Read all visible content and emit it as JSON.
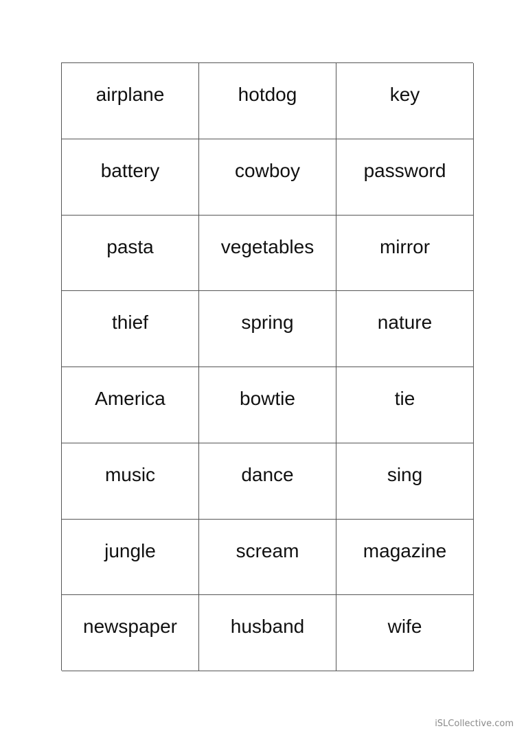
{
  "cards": [
    "airplane",
    "hotdog",
    "key",
    "battery",
    "cowboy",
    "password",
    "pasta",
    "vegetables",
    "mirror",
    "thief",
    "spring",
    "nature",
    "America",
    "bowtie",
    "tie",
    "music",
    "dance",
    "sing",
    "jungle",
    "scream",
    "magazine",
    "newspaper",
    "husband",
    "wife"
  ],
  "watermark": "iSLCollective.com"
}
